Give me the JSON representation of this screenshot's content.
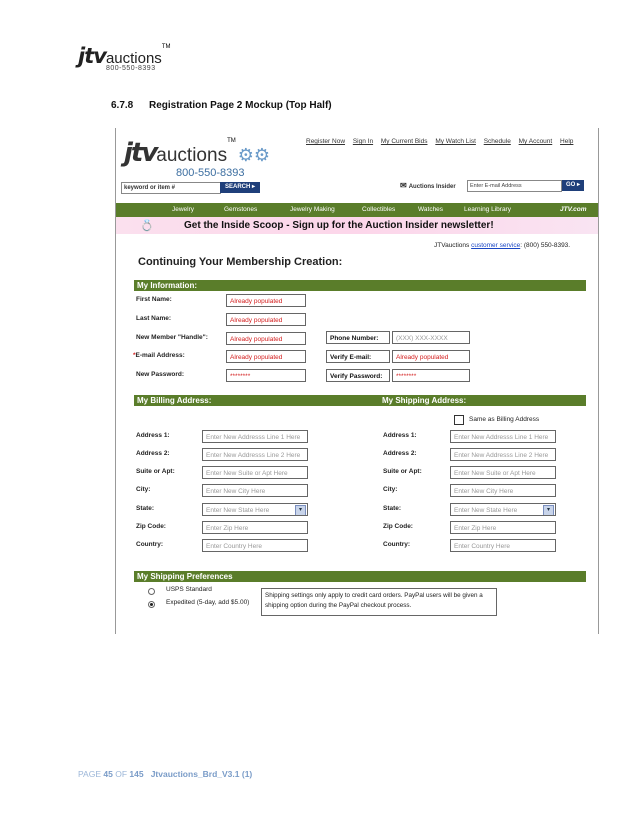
{
  "doc": {
    "logo_jtv": "jtv",
    "logo_auctions": "auctions",
    "logo_tm": "TM",
    "logo_phone": "800-550-8393",
    "section_number": "6.7.8",
    "section_title": "Registration Page 2 Mockup (Top Half)",
    "footer": {
      "page_prefix": "PAGE",
      "page": "45",
      "of": "OF",
      "total": "145",
      "file": "Jtvauctions_Brd_V3.1 (1)"
    }
  },
  "mockup": {
    "logo_jtv": "jtv",
    "logo_auctions": "auctions",
    "logo_tm": "TM",
    "logo_phone": "800-550-8393",
    "top_links": [
      "Register Now",
      "Sign In",
      "My Current Bids",
      "My Watch List",
      "Schedule",
      "My Account",
      "Help"
    ],
    "search_placeholder": "keyword or item #",
    "search_button": "SEARCH ▸",
    "insider_label": "Auctions Insider",
    "insider_placeholder": "Enter E-mail Address",
    "go_button": "GO ▸",
    "nav": [
      "Jewelry",
      "Gemstones",
      "Jewelry Making",
      "Collectibles",
      "Watches",
      "Learning Library",
      "JTV.com"
    ],
    "promo": "Get the Inside Scoop - Sign up for the Auction Insider newsletter!",
    "service_prefix": "JTVauctions",
    "service_link": "customer service",
    "service_phone": ": (800) 550-8393.",
    "heading": "Continuing Your Membership Creation:",
    "my_info": {
      "title": "My Information:",
      "first_name_label": "First Name:",
      "first_name_value": "Already populated",
      "last_name_label": "Last Name:",
      "last_name_value": "Already populated",
      "handle_label": "New Member \"Handle\":",
      "handle_value": "Already populated",
      "email_label": "E-mail Address:",
      "email_value": "Already populated",
      "password_label": "New Password:",
      "password_value": "********",
      "phone_label": "Phone Number:",
      "phone_placeholder": "(XXX) XXX-XXXX",
      "verify_email_label": "Verify E-mail:",
      "verify_email_value": "Already populated",
      "verify_password_label": "Verify Password:",
      "verify_password_value": "********"
    },
    "billing": {
      "title": "My Billing Address:",
      "address1_label": "Address 1:",
      "address1_ph": "Enter New Addresss Line 1 Here",
      "address2_label": "Address 2:",
      "address2_ph": "Enter New Addresss Line 2 Here",
      "suite_label": "Suite or Apt:",
      "suite_ph": "Enter  New Suite or Apt Here",
      "city_label": "City:",
      "city_ph": "Enter New City Here",
      "state_label": "State:",
      "state_ph": "Enter New State Here",
      "zip_label": "Zip Code:",
      "zip_ph": "Enter Zip Here",
      "country_label": "Country:",
      "country_ph": "Enter Country Here"
    },
    "shipping": {
      "title": "My Shipping Address:",
      "same_as_billing": "Same as Billing Address",
      "address1_label": "Address 1:",
      "address1_ph": "Enter New Addresss Line 1 Here",
      "address2_label": "Address 2:",
      "address2_ph": "Enter New Addresss Line 2 Here",
      "suite_label": "Suite or Apt:",
      "suite_ph": "Enter  New Suite or Apt Here",
      "city_label": "City:",
      "city_ph": "Enter New City Here",
      "state_label": "State:",
      "state_ph": "Enter New State Here",
      "zip_label": "Zip Code:",
      "zip_ph": "Enter Zip Here",
      "country_label": "Country:",
      "country_ph": "Enter Country Here"
    },
    "prefs": {
      "title": "My Shipping Preferences",
      "option1": "USPS Standard",
      "option2": "Expedited (5-day, add $5.00)",
      "selected": "Expedited (5-day, add $5.00)",
      "note": "Shipping settings only apply to credit card orders. PayPal users will be given a shipping option during the PayPal checkout process."
    },
    "colors": {
      "green_bar": "#5a7d2a",
      "required": "#d31d1d",
      "link": "#1a46c4",
      "button": "#1f3f7a"
    }
  }
}
